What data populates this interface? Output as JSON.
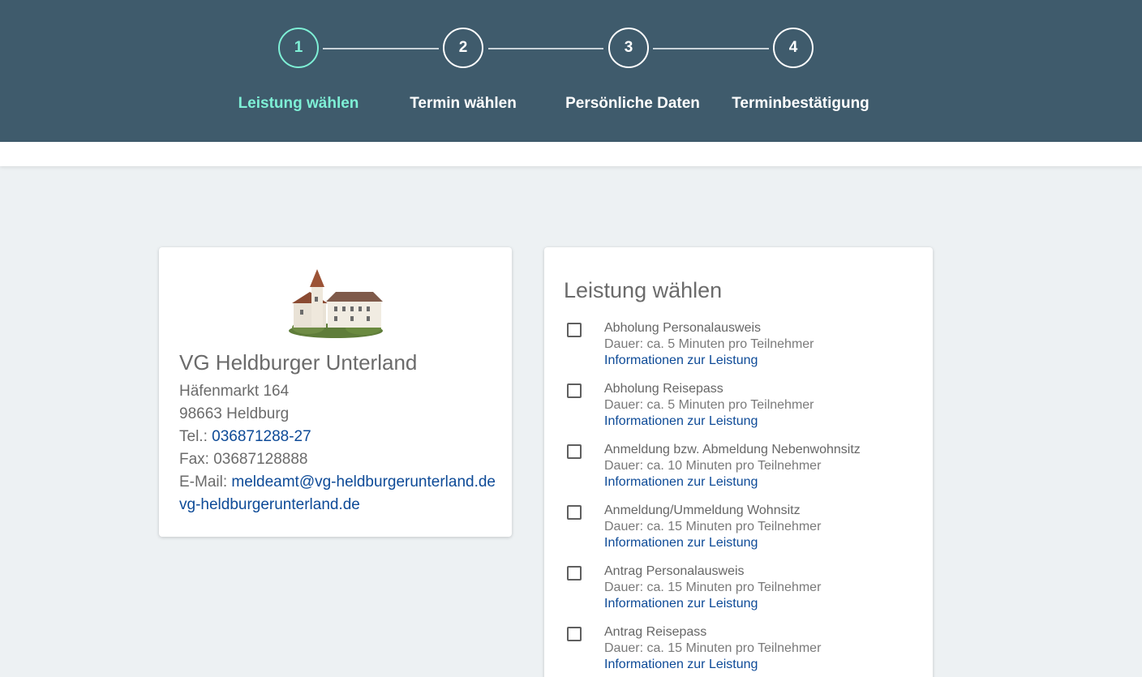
{
  "steps": [
    {
      "number": "1",
      "label": "Leistung wählen",
      "active": true
    },
    {
      "number": "2",
      "label": "Termin wählen",
      "active": false
    },
    {
      "number": "3",
      "label": "Persönliche Daten",
      "active": false
    },
    {
      "number": "4",
      "label": "Terminbestätigung",
      "active": false
    }
  ],
  "office": {
    "name": "VG Heldburger Unterland",
    "street": "Häfenmarkt 164",
    "city": "98663 Heldburg",
    "tel_label": "Tel.: ",
    "tel": "036871288-27",
    "fax": "Fax: 03687128888",
    "email_label": "E-Mail: ",
    "email": "meldeamt@vg-heldburgerunterland.de",
    "website": "vg-heldburgerunterland.de"
  },
  "services": {
    "title": "Leistung wählen",
    "items": [
      {
        "name": "Abholung Personalausweis",
        "duration": "Dauer: ca. 5 Minuten pro Teilnehmer",
        "link": "Informationen zur Leistung"
      },
      {
        "name": "Abholung Reisepass",
        "duration": "Dauer: ca. 5 Minuten pro Teilnehmer",
        "link": "Informationen zur Leistung"
      },
      {
        "name": "Anmeldung bzw. Abmeldung Nebenwohnsitz",
        "duration": "Dauer: ca. 10 Minuten pro Teilnehmer",
        "link": "Informationen zur Leistung"
      },
      {
        "name": "Anmeldung/Ummeldung Wohnsitz",
        "duration": "Dauer: ca. 15 Minuten pro Teilnehmer",
        "link": "Informationen zur Leistung"
      },
      {
        "name": "Antrag Personalausweis",
        "duration": "Dauer: ca. 15 Minuten pro Teilnehmer",
        "link": "Informationen zur Leistung"
      },
      {
        "name": "Antrag Reisepass",
        "duration": "Dauer: ca. 15 Minuten pro Teilnehmer",
        "link": "Informationen zur Leistung"
      }
    ]
  },
  "colors": {
    "header_bg": "#3f5b6c",
    "active_step": "#7ef0d6",
    "page_bg": "#edf1f3",
    "link": "#0d4a97"
  }
}
